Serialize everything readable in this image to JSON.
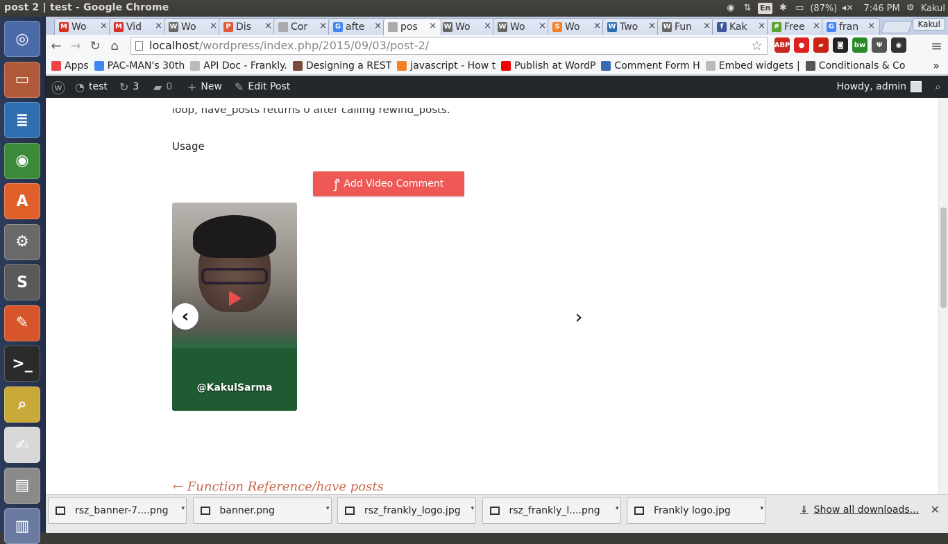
{
  "window": {
    "title": "post 2 | test - Google Chrome"
  },
  "tray": {
    "keyboard": "En",
    "battery": "(87%)",
    "time": "7:46 PM",
    "user": "Kakul"
  },
  "launcher": {
    "items": [
      {
        "name": "ubuntu-dash",
        "glyph": "◎",
        "color": "#4a6aa8"
      },
      {
        "name": "files",
        "glyph": "▭",
        "color": "#b05a3a"
      },
      {
        "name": "writer",
        "glyph": "≣",
        "color": "#2f6fb1"
      },
      {
        "name": "chrome",
        "glyph": "◉",
        "color": "#3a8a3a"
      },
      {
        "name": "software-center",
        "glyph": "A",
        "color": "#e0602a"
      },
      {
        "name": "settings",
        "glyph": "⚙",
        "color": "#6a6a6a"
      },
      {
        "name": "sublime",
        "glyph": "S",
        "color": "#5a5a5a"
      },
      {
        "name": "inkscape",
        "glyph": "✎",
        "color": "#d6552a"
      },
      {
        "name": "terminal",
        "glyph": ">_",
        "color": "#2b2b2b"
      },
      {
        "name": "image-viewer",
        "glyph": "⌕",
        "color": "#c9a93a"
      },
      {
        "name": "text-editor",
        "glyph": "✍",
        "color": "#d8d8d8"
      },
      {
        "name": "scanner",
        "glyph": "▤",
        "color": "#8a8a8a"
      },
      {
        "name": "trash",
        "glyph": "▥",
        "color": "#6a7aa0"
      }
    ]
  },
  "tabs": [
    {
      "label": "Wo",
      "icon": "gmail-icon",
      "color": "#d93025",
      "glyph": "M"
    },
    {
      "label": "Vid",
      "icon": "gmail-icon",
      "color": "#d93025",
      "glyph": "M"
    },
    {
      "label": "Wo",
      "icon": "wordpress-icon",
      "color": "#666",
      "glyph": "W"
    },
    {
      "label": "Dis",
      "icon": "pdf-icon",
      "color": "#e0583a",
      "glyph": "P"
    },
    {
      "label": "Cor",
      "icon": "page-icon",
      "color": "#aaa",
      "glyph": ""
    },
    {
      "label": "afte",
      "icon": "google-icon",
      "color": "#4285f4",
      "glyph": "G"
    },
    {
      "label": "pos",
      "icon": "page-icon",
      "color": "#aaa",
      "glyph": "",
      "active": true
    },
    {
      "label": "Wo",
      "icon": "wordpress-icon",
      "color": "#666",
      "glyph": "W"
    },
    {
      "label": "Wo",
      "icon": "wordpress-icon",
      "color": "#666",
      "glyph": "W"
    },
    {
      "label": "Wo",
      "icon": "stackoverflow-icon",
      "color": "#f48024",
      "glyph": "S"
    },
    {
      "label": "Two",
      "icon": "twitter-icon",
      "color": "#2c6fb1",
      "glyph": "W"
    },
    {
      "label": "Fun",
      "icon": "wordpress-icon",
      "color": "#666",
      "glyph": "W"
    },
    {
      "label": "Kak",
      "icon": "facebook-icon",
      "color": "#3b5998",
      "glyph": "f"
    },
    {
      "label": "Free",
      "icon": "grid-icon",
      "color": "#5aa02c",
      "glyph": "#"
    },
    {
      "label": "fran",
      "icon": "google-icon",
      "color": "#4285f4",
      "glyph": "G"
    }
  ],
  "profile": "Kakul",
  "address": {
    "host": "localhost",
    "path": "/wordpress/index.php/2015/09/03/post-2/"
  },
  "extensions": [
    {
      "name": "adblock-icon",
      "label": "ABP",
      "color": "#c7281f"
    },
    {
      "name": "stop-icon",
      "label": "●",
      "color": "#d22"
    },
    {
      "name": "train-icon",
      "label": "▰",
      "color": "#c21"
    },
    {
      "name": "glasses-icon",
      "label": "◙",
      "color": "#222"
    },
    {
      "name": "bw-icon",
      "label": "bw",
      "color": "#2a8a2a"
    },
    {
      "name": "tree-icon",
      "label": "Ψ",
      "color": "#555"
    },
    {
      "name": "color-icon",
      "label": "◉",
      "color": "#333"
    }
  ],
  "bookmarks": [
    {
      "label": "Apps",
      "icon": "apps-icon",
      "color": "#e44"
    },
    {
      "label": "PAC-MAN's 30th",
      "icon": "google-icon",
      "color": "#4285f4"
    },
    {
      "label": "API Doc - Frankly.",
      "icon": "page-icon",
      "color": "#bbb"
    },
    {
      "label": "Designing a REST",
      "icon": "photo-icon",
      "color": "#7a4a3a"
    },
    {
      "label": "javascript - How t",
      "icon": "stackoverflow-icon",
      "color": "#f48024"
    },
    {
      "label": "Publish at WordP",
      "icon": "youtube-icon",
      "color": "#e00"
    },
    {
      "label": "Comment Form H",
      "icon": "gear-icon",
      "color": "#3a6ab0"
    },
    {
      "label": "Embed widgets |",
      "icon": "page-icon",
      "color": "#bbb"
    },
    {
      "label": "Conditionals & Co",
      "icon": "doc-icon",
      "color": "#555"
    }
  ],
  "adminbar": {
    "site": "test",
    "updates": "3",
    "comments": "0",
    "new": "New",
    "edit": "Edit Post",
    "howdy": "Howdy, admin"
  },
  "post": {
    "cut_text": "loop, have_posts returns 0 after calling rewind_posts.",
    "usage": "Usage",
    "add_video": "Add Video Comment",
    "handle": "@KakulSarma",
    "prev_link": "← Function Reference/have posts"
  },
  "downloads": [
    {
      "name": "rsz_banner-7....png"
    },
    {
      "name": "banner.png"
    },
    {
      "name": "rsz_frankly_logo.jpg"
    },
    {
      "name": "rsz_frankly_l....png"
    },
    {
      "name": "Frankly logo.jpg"
    }
  ],
  "show_all": "Show all downloads..."
}
